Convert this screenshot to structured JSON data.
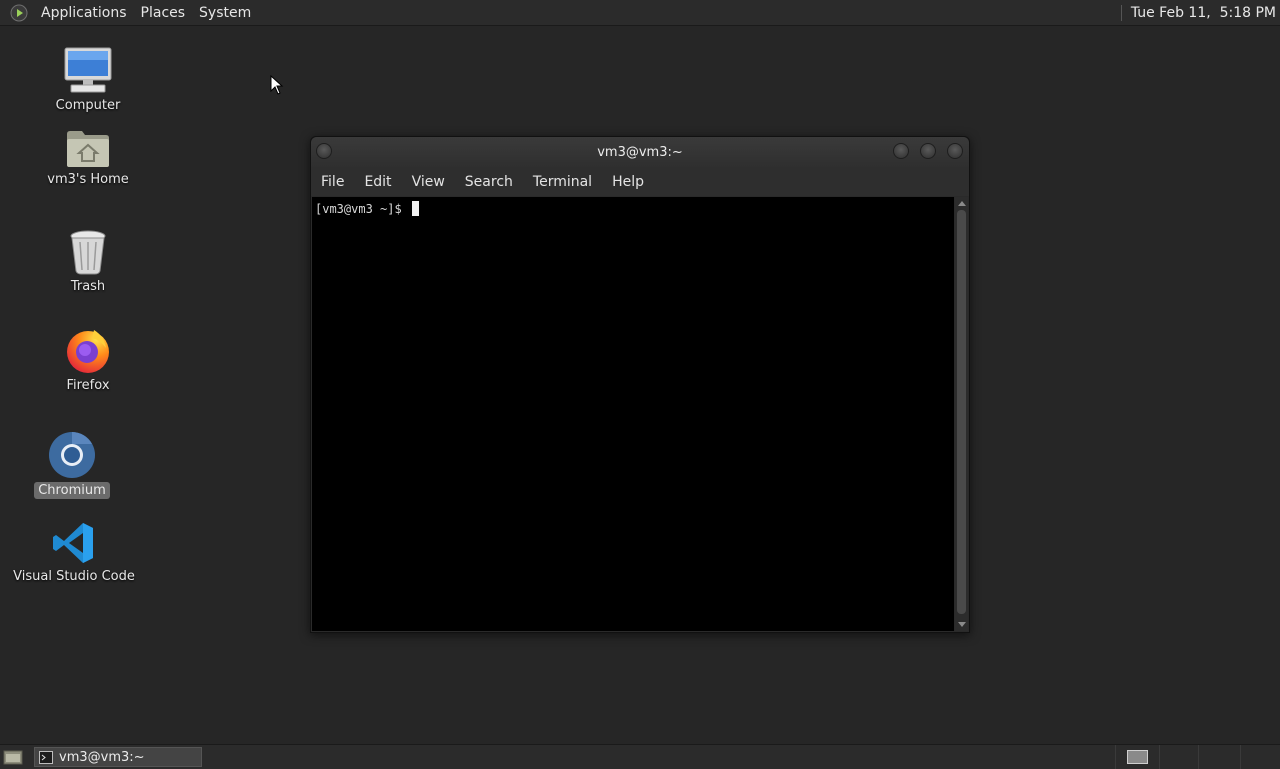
{
  "top_panel": {
    "menus": [
      "Applications",
      "Places",
      "System"
    ],
    "clock": "Tue Feb 11,  5:18 PM"
  },
  "desktop_icons": [
    {
      "label": "Computer",
      "icon": "computer-icon"
    },
    {
      "label": "vm3's Home",
      "icon": "home-folder-icon"
    },
    {
      "label": "Trash",
      "icon": "trash-icon"
    },
    {
      "label": "Firefox",
      "icon": "firefox-icon"
    },
    {
      "label": "Chromium",
      "icon": "chromium-icon",
      "selected": true
    },
    {
      "label": "Visual Studio Code",
      "icon": "vscode-icon"
    }
  ],
  "terminal": {
    "title": "vm3@vm3:~",
    "menus": [
      "File",
      "Edit",
      "View",
      "Search",
      "Terminal",
      "Help"
    ],
    "prompt": "[vm3@vm3 ~]$ "
  },
  "taskbar": {
    "tasks": [
      {
        "label": "vm3@vm3:~",
        "icon": "terminal-icon"
      }
    ],
    "workspaces": 4,
    "active_workspace": 1
  },
  "colors": {
    "desktop_bg": "#262626",
    "panel_bg": "#2b2b2b",
    "terminal_bg": "#000000",
    "selection_bg": "#6b6b6b"
  }
}
